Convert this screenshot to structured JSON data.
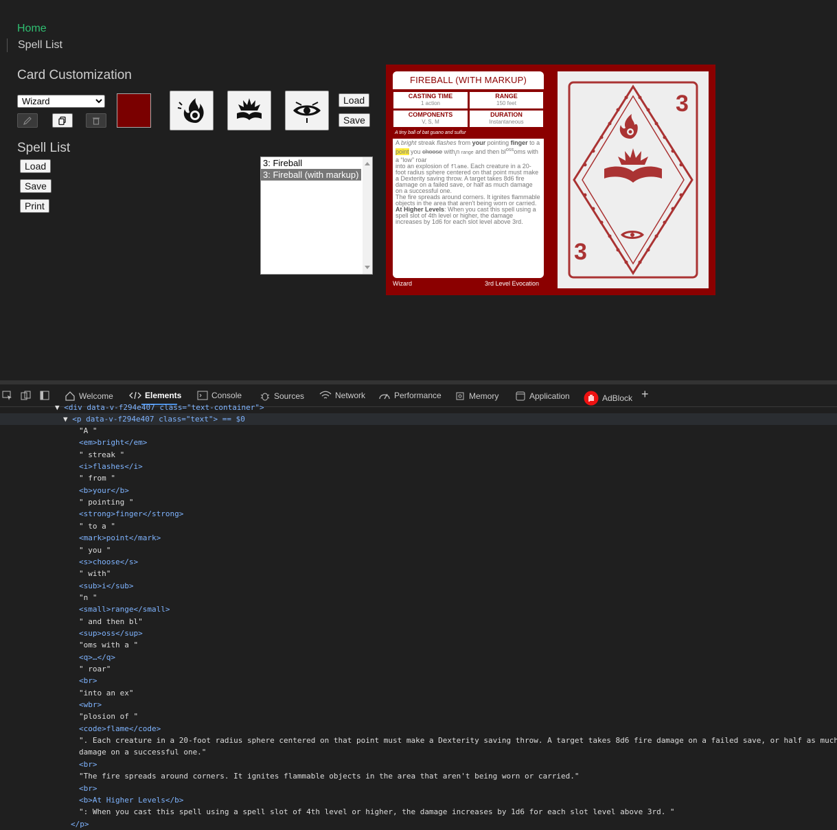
{
  "nav": {
    "home": "Home",
    "spell_list": "Spell List"
  },
  "customization": {
    "title": "Card Customization",
    "class_select_value": "Wizard",
    "color": "#7a0000",
    "load": "Load",
    "save": "Save",
    "icons": [
      "fire-spell-icon",
      "book-burst-icon",
      "eye-icon"
    ]
  },
  "spell_list": {
    "title": "Spell List",
    "load": "Load",
    "save": "Save",
    "print": "Print",
    "items": [
      "3: Fireball",
      "3: Fireball (with markup)"
    ],
    "selected_index": 1
  },
  "card": {
    "title": "FIREBALL (WITH MARKUP)",
    "casting_time_label": "CASTING TIME",
    "casting_time": "1 action",
    "range_label": "RANGE",
    "range": "150 feet",
    "components_label": "COMPONENTS",
    "components": "V, S, M",
    "duration_label": "DURATION",
    "duration": "Instantaneous",
    "material": "A tiny ball of bat guano and sulfur",
    "text": {
      "a": "A ",
      "bright": "bright",
      "streak": " streak ",
      "flashes": "flashes",
      "from": " from ",
      "your": "your",
      "pointing": " pointing ",
      "finger": "finger",
      "to_a": " to a ",
      "point": "point",
      "you": " you ",
      "choose": "choose",
      "with": " with",
      "i": "i",
      "n": "n ",
      "range": "range",
      "and_then": " and then bl",
      "oss": "oss",
      "oms": "oms with a ",
      "low": "“low”",
      "roar": " roar",
      "into": "into an ex",
      "plosion": "plosion of ",
      "flame": "flame",
      "p1": ". Each creature in a 20-foot radius sphere centered on that point must make a Dexterity saving throw. A target takes 8d6 fire damage on a failed save, or half as much damage on a successful one.",
      "p2": "The fire spreads around corners. It ignites flammable objects in the area that aren't being worn or carried.",
      "higher_label": "At Higher Levels",
      "p3": ": When you cast this spell using a spell slot of 4th level or higher, the damage increases by 1d6 for each slot level above 3rd."
    },
    "footer_class": "Wizard",
    "footer_level": "3rd Level Evocation",
    "back_level": "3"
  },
  "devtools": {
    "tabs": [
      "Welcome",
      "Elements",
      "Console",
      "Sources",
      "Network",
      "Performance",
      "Memory",
      "Application",
      "AdBlock"
    ],
    "active_tab": "Elements",
    "lines": [
      "\"A \"",
      "<em>bright</em>",
      "\" streak \"",
      "<i>flashes</i>",
      "\" from \"",
      "<b>your</b>",
      "\" pointing \"",
      "<strong>finger</strong>",
      "\" to a \"",
      "<mark>point</mark>",
      "\" you \"",
      "<s>choose</s>",
      "\" with\"",
      "<sub>i</sub>",
      "\"n \"",
      "<small>range</small>",
      "\" and then bl\"",
      "<sup>oss</sup>",
      "\"oms with a \"",
      "<q>…</q>",
      "\" roar\"",
      "<br>",
      "\"into an ex\"",
      "<wbr>",
      "\"plosion of \"",
      "<code>flame</code>",
      "\". Each creature in a 20-foot radius sphere centered on that point must make a Dexterity saving throw. A target takes 8d6 fire damage on a failed save, or half as much",
      "damage on a successful one.\"",
      "<br>",
      "\"The fire spreads around corners. It ignites flammable objects in the area that aren't being worn or carried.\"",
      "<br>",
      "<b>At Higher Levels</b>",
      "\": When you cast this spell using a spell slot of 4th level or higher, the damage increases by 1d6 for each slot level above 3rd. \"",
      "</p>"
    ],
    "container_line": "<div data-v-f294e407 class=\"text-container\">",
    "selected_line": "<p data-v-f294e407 class=\"text\"> == $0"
  }
}
